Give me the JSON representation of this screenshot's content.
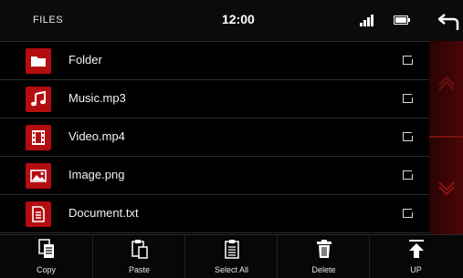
{
  "status": {
    "title": "FILES",
    "time": "12:00",
    "icons": [
      "signal-icon",
      "battery-icon",
      "back-arrow-icon"
    ]
  },
  "accent": "#b40d10",
  "files": [
    {
      "name": "Folder",
      "icon": "folder-icon"
    },
    {
      "name": "Music.mp3",
      "icon": "music-note-icon"
    },
    {
      "name": "Video.mp4",
      "icon": "film-icon"
    },
    {
      "name": "Image.png",
      "icon": "image-icon"
    },
    {
      "name": "Document.txt",
      "icon": "document-icon"
    }
  ],
  "scroll": {
    "up_icon": "chevron-up-icon",
    "down_icon": "chevron-down-icon"
  },
  "toolbar": {
    "copy": "Copy",
    "paste": "Paste",
    "select_all": "Select All",
    "delete": "Delete",
    "up": "UP"
  }
}
